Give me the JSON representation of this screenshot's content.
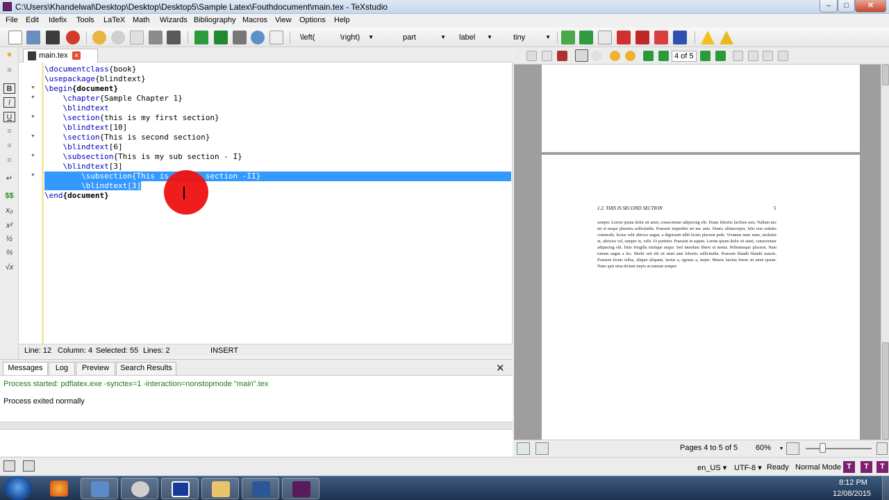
{
  "window": {
    "title": "C:\\Users\\Khandelwal\\Desktop\\Desktop\\Desktop5\\Sample Latex\\Fouthdocument\\main.tex - TeXstudio",
    "min_label": "–",
    "max_label": "□",
    "close_label": "✕"
  },
  "menu": [
    "File",
    "Edit",
    "Idefix",
    "Tools",
    "LaTeX",
    "Math",
    "Wizards",
    "Bibliography",
    "Macros",
    "View",
    "Options",
    "Help"
  ],
  "toolbar": {
    "left_combo": "\\left(",
    "right_combo": "\\right)",
    "section_combo": "part",
    "ref_combo": "label",
    "size_combo": "tiny",
    "dropdown_arrow": "▼"
  },
  "sidebar": {
    "bold": "B",
    "italic": "I",
    "underline": "U",
    "newline": "↵",
    "math": "$$",
    "subscript": "x₀",
    "superscript": "x²",
    "frac": "½",
    "dfrac": "⅔",
    "sqrt": "√x"
  },
  "tab": {
    "label": "main.tex",
    "close": "✕"
  },
  "code": {
    "l1_cmd": "\\documentclass",
    "l1_arg": "{book}",
    "l2_cmd": "\\usepackage",
    "l2_arg": "{blindtext}",
    "l3_cmd": "\\begin",
    "l3_arg": "{document}",
    "l4_cmd": "\\chapter",
    "l4_arg": "{Sample Chapter 1}",
    "l5_cmd": "\\blindtext",
    "l6_cmd": "\\section",
    "l6_arg": "{this is my first section}",
    "l7_cmd": "\\blindtext",
    "l7_arg": "[10]",
    "l8_cmd": "\\section",
    "l8_arg": "{This is second section}",
    "l9_cmd": "\\blindtext",
    "l9_arg": "[6]",
    "l10_cmd": "\\subsection",
    "l10_arg": "{This is my sub section - I}",
    "l11_cmd": "\\blindtext",
    "l11_arg": "[3]",
    "l12_cmd": "\\subsection",
    "l12_arg": "{This is my sub section -II}",
    "l13_cmd": "\\blindtext",
    "l13_arg": "[3]",
    "l14_cmd": "\\end",
    "l14_arg": "{document}"
  },
  "status": {
    "line": "Line: 12",
    "column": "Column: 4",
    "selected": "Selected: 55",
    "lines": "Lines: 2",
    "mode": "INSERT"
  },
  "messages": {
    "tabs": [
      "Messages",
      "Log",
      "Preview",
      "Search Results"
    ],
    "close": "✕",
    "line1": "Process started: pdflatex.exe -synctex=1 -interaction=nonstopmode \"main\".tex",
    "line2": "Process exited normally"
  },
  "pdf": {
    "page_indicator": "4 of 5",
    "header_left": "1.2.   THIS IS SECOND SECTION",
    "header_right": "5",
    "body": "semper. Lorem ipsum dolor sit amet, consectetuer adipiscing elit. Etiam lobortis facilisis sem. Nullam nec mi et neque pharetra sollicitudin. Praesent imperdiet mi nec ante. Donec ullamcorper, felis non sodales commodo, lectus velit ultrices augue, a dignissim nibh lectus placerat pede. Vivamus nunc nunc, molestie ut, ultricies vel, semper in, velit. Ut porttitor. Praesent in sapien. Lorem ipsum dolor sit amet, consectetuer adipiscing elit. Duis fringilla tristique neque. Sed interdum libero ut metus. Pellentesque placerat. Nam rutrum augue a leo. Morbi sed elit sit amet ante lobortis sollicitudin. Praesent blandit blandit mauris. Praesent lectus tellus, aliquet aliquam, luctus a, egestas a, turpis. Mauris lacinia lorem sit amet ipsum. Nunc quis urna dictum turpis accumsan semper.",
    "pages": "Pages 4 to 5 of 5",
    "zoom": "60%"
  },
  "bottom": {
    "language": "en_US",
    "encoding": "UTF-8",
    "state": "Ready",
    "mode": "Normal Mode",
    "arrow": "▾"
  },
  "clock": {
    "time": "8:12 PM",
    "date": "12/08/2015"
  }
}
